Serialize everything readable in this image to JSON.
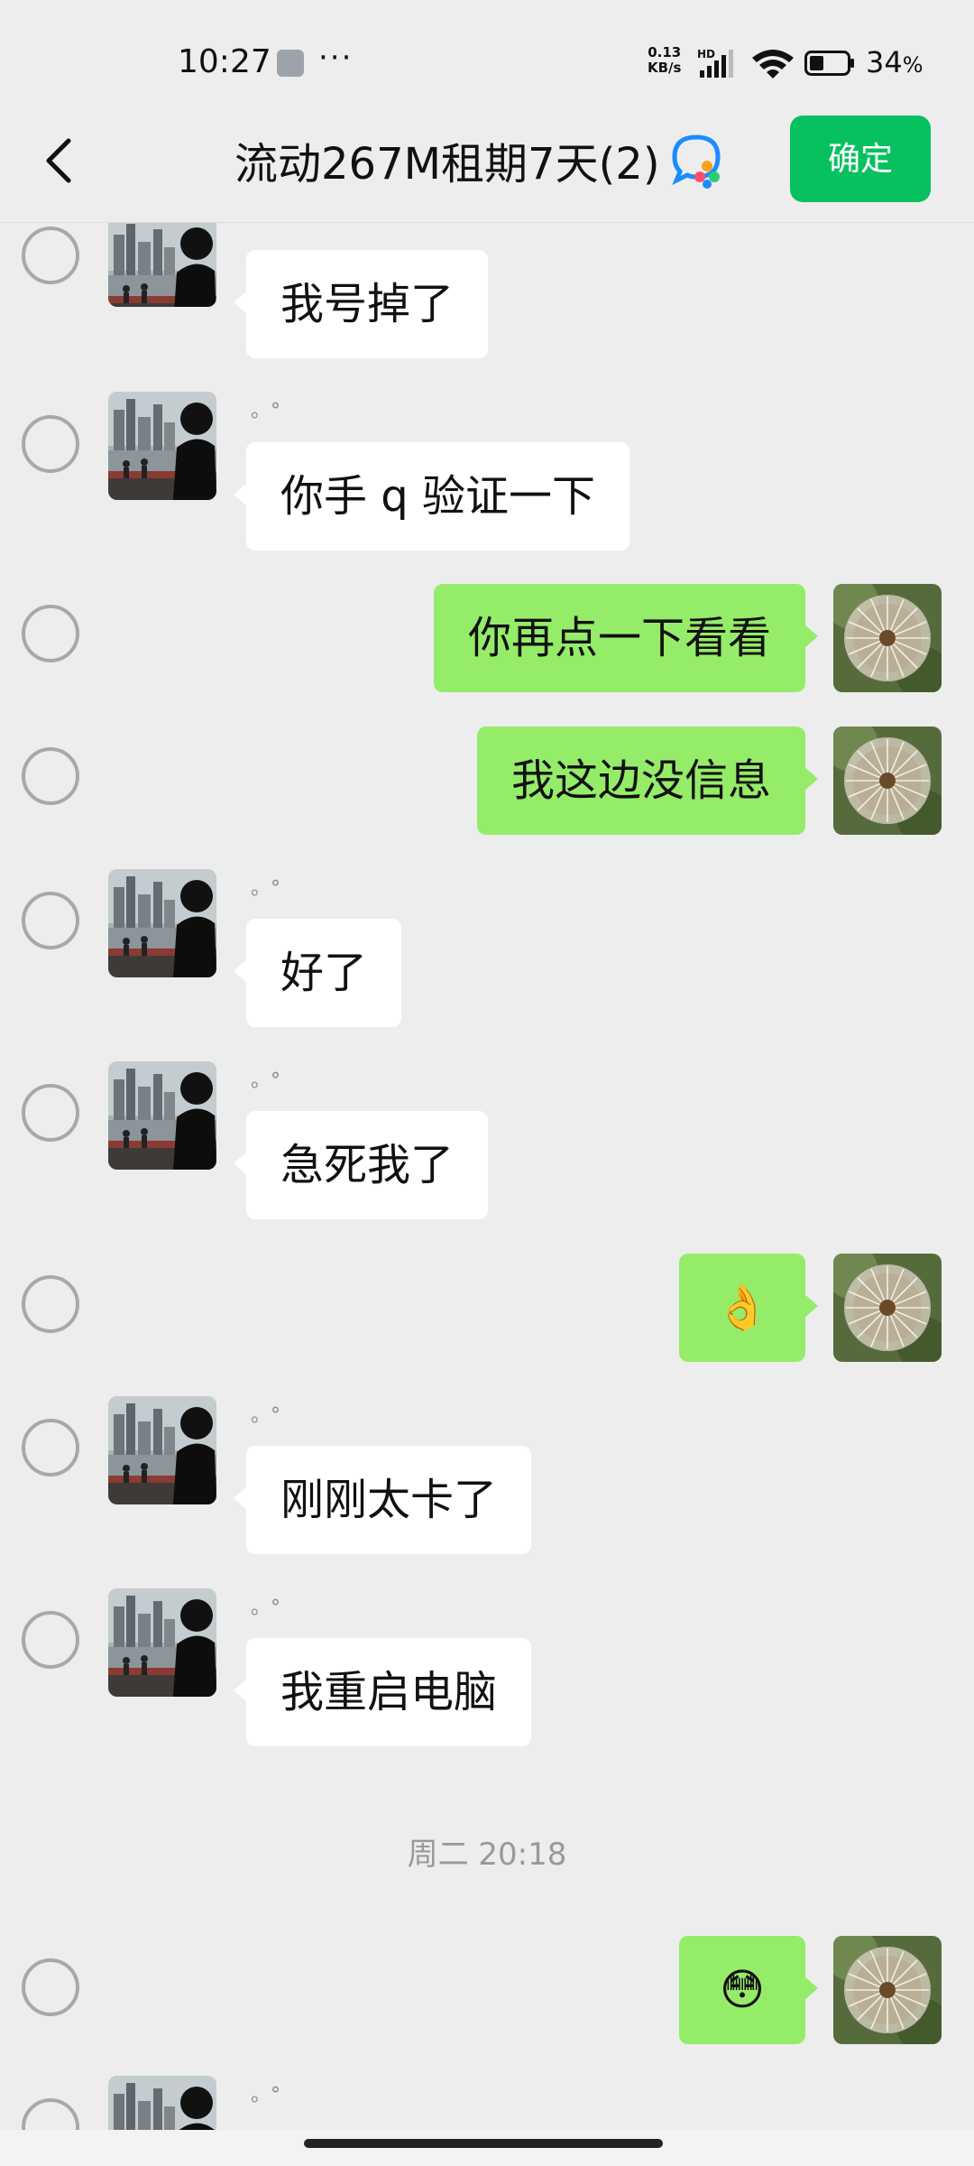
{
  "status_bar": {
    "time": "10:27",
    "dots": "···",
    "net_speed_value": "0.13",
    "net_speed_unit": "KB/s",
    "hd_label": "HD",
    "battery_percent": "34",
    "percent_sign": "%"
  },
  "header": {
    "title": "流动267M租期7天(2)",
    "confirm_label": "确定"
  },
  "messages": [
    {
      "side": "left",
      "text": "我号掉了",
      "nick": ""
    },
    {
      "side": "left",
      "text": "你手 q 验证一下",
      "nick": "。°"
    },
    {
      "side": "right",
      "text": "你再点一下看看"
    },
    {
      "side": "right",
      "text": "我这边没信息"
    },
    {
      "side": "left",
      "text": "好了",
      "nick": "。°"
    },
    {
      "side": "left",
      "text": "急死我了",
      "nick": "。°"
    },
    {
      "side": "right",
      "text": "👌"
    },
    {
      "side": "left",
      "text": "刚刚太卡了",
      "nick": "。°"
    },
    {
      "side": "left",
      "text": "我重启电脑",
      "nick": "。°"
    },
    {
      "side": "right",
      "text": "😳"
    },
    {
      "side": "left",
      "text": "",
      "nick": "。°"
    }
  ],
  "timestamp": "周二 20:18",
  "colors": {
    "accent": "#07c160",
    "bubble_self": "#95ec69",
    "bubble_other": "#ffffff",
    "background": "#ededed"
  },
  "icons": {
    "back": "chevron-left-icon",
    "group": "group-chat-icon"
  }
}
